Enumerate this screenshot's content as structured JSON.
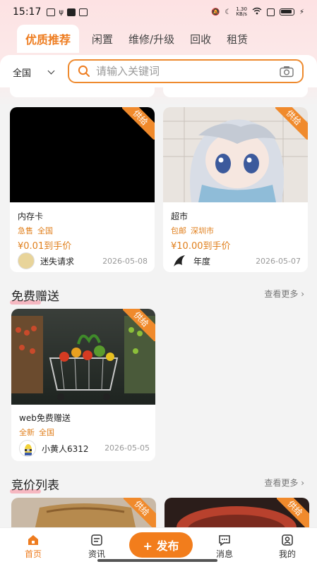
{
  "status_bar": {
    "time": "15:17",
    "net_speed": "1.30\nKB/s"
  },
  "tabs": [
    {
      "label": "优质推荐",
      "active": true
    },
    {
      "label": "闲置",
      "active": false
    },
    {
      "label": "维修/升级",
      "active": false
    },
    {
      "label": "回收",
      "active": false
    },
    {
      "label": "租赁",
      "active": false
    }
  ],
  "search": {
    "region": "全国",
    "placeholder": "请输入关键词"
  },
  "recommended": [
    {
      "ribbon": "供给",
      "title": "内存卡",
      "tags": [
        "急售",
        "全国"
      ],
      "price": "¥0.01到手价",
      "seller": "迷失请求",
      "date": "2026-05-08"
    },
    {
      "ribbon": "供给",
      "title": "超市",
      "tags": [
        "包邮",
        "深圳市"
      ],
      "price": "¥10.00到手价",
      "seller": "年度",
      "date": "2026-05-07"
    }
  ],
  "free_section": {
    "title": "免费赠送",
    "more": "查看更多 ›"
  },
  "free_items": [
    {
      "ribbon": "供给",
      "title": "web免费赠送",
      "tags": [
        "全新",
        "全国"
      ],
      "seller": "小黄人6312",
      "date": "2026-05-05"
    }
  ],
  "auction_section": {
    "title": "竞价列表",
    "more": "查看更多 ›"
  },
  "auction_items": [
    {
      "ribbon": "供给"
    },
    {
      "ribbon": "供给"
    }
  ],
  "bottom_nav": {
    "home": "首页",
    "news": "资讯",
    "publish": "+ 发布",
    "messages": "消息",
    "mine": "我的"
  },
  "colors": {
    "accent": "#ee7c1f",
    "ribbon": "#f08a2c",
    "highlight": "#f7a4b0"
  }
}
